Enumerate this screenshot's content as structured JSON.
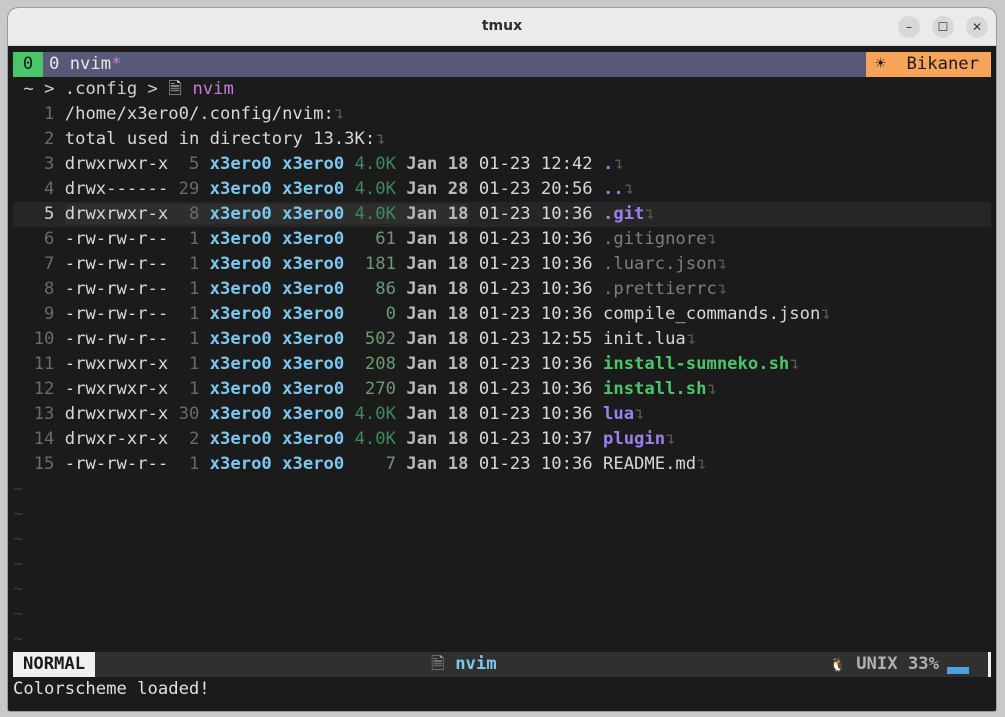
{
  "window": {
    "title": "tmux",
    "minimize_icon": "minimize-icon",
    "maximize_icon": "maximize-icon",
    "close_icon": "close-icon"
  },
  "tmux": {
    "pane_index": "0",
    "window_label": "0 nvim",
    "window_flag": "*",
    "session": "☀  Bikaner"
  },
  "breadcrumb": {
    "home": "~",
    "sep1": " > ",
    "dir": ".config",
    "sep2": " > ",
    "file_icon": "🗎",
    "current": "nvim"
  },
  "lines": [
    {
      "n": "1",
      "text": "/home/x3ero0/.config/nvim:"
    },
    {
      "n": "2",
      "text": "total used in directory 13.3K:"
    },
    {
      "n": "3",
      "perm": "drwxrwxr-x",
      "links": " 5",
      "user": "x3ero0",
      "group": "x3ero0",
      "size": "4.0K",
      "mon": "Jan",
      "day": "18",
      "time": "01-23 12:42",
      "name": ".",
      "kind": "dir"
    },
    {
      "n": "4",
      "perm": "drwx------",
      "links": "29",
      "user": "x3ero0",
      "group": "x3ero0",
      "size": "4.0K",
      "mon": "Jan",
      "day": "28",
      "time": "01-23 20:56",
      "name": "..",
      "kind": "dir"
    },
    {
      "n": "5",
      "perm": "drwxrwxr-x",
      "links": " 8",
      "user": "x3ero0",
      "group": "x3ero0",
      "size": "4.0K",
      "mon": "Jan",
      "day": "18",
      "time": "01-23 10:36",
      "name": ".git",
      "kind": "dir",
      "current": true
    },
    {
      "n": "6",
      "perm": "-rw-rw-r--",
      "links": " 1",
      "user": "x3ero0",
      "group": "x3ero0",
      "size": "  61",
      "mon": "Jan",
      "day": "18",
      "time": "01-23 10:36",
      "name": ".gitignore",
      "kind": "hidden"
    },
    {
      "n": "7",
      "perm": "-rw-rw-r--",
      "links": " 1",
      "user": "x3ero0",
      "group": "x3ero0",
      "size": " 181",
      "mon": "Jan",
      "day": "18",
      "time": "01-23 10:36",
      "name": ".luarc.json",
      "kind": "hidden"
    },
    {
      "n": "8",
      "perm": "-rw-rw-r--",
      "links": " 1",
      "user": "x3ero0",
      "group": "x3ero0",
      "size": "  86",
      "mon": "Jan",
      "day": "18",
      "time": "01-23 10:36",
      "name": ".prettierrc",
      "kind": "hidden"
    },
    {
      "n": "9",
      "perm": "-rw-rw-r--",
      "links": " 1",
      "user": "x3ero0",
      "group": "x3ero0",
      "size": "   0",
      "mon": "Jan",
      "day": "18",
      "time": "01-23 10:36",
      "name": "compile_commands.json",
      "kind": "plain"
    },
    {
      "n": "10",
      "perm": "-rw-rw-r--",
      "links": " 1",
      "user": "x3ero0",
      "group": "x3ero0",
      "size": " 502",
      "mon": "Jan",
      "day": "18",
      "time": "01-23 12:55",
      "name": "init.lua",
      "kind": "plain"
    },
    {
      "n": "11",
      "perm": "-rwxrwxr-x",
      "links": " 1",
      "user": "x3ero0",
      "group": "x3ero0",
      "size": " 208",
      "mon": "Jan",
      "day": "18",
      "time": "01-23 10:36",
      "name": "install-sumneko.sh",
      "kind": "exec"
    },
    {
      "n": "12",
      "perm": "-rwxrwxr-x",
      "links": " 1",
      "user": "x3ero0",
      "group": "x3ero0",
      "size": " 270",
      "mon": "Jan",
      "day": "18",
      "time": "01-23 10:36",
      "name": "install.sh",
      "kind": "exec"
    },
    {
      "n": "13",
      "perm": "drwxrwxr-x",
      "links": "30",
      "user": "x3ero0",
      "group": "x3ero0",
      "size": "4.0K",
      "mon": "Jan",
      "day": "18",
      "time": "01-23 10:36",
      "name": "lua",
      "kind": "dir"
    },
    {
      "n": "14",
      "perm": "drwxr-xr-x",
      "links": " 2",
      "user": "x3ero0",
      "group": "x3ero0",
      "size": "4.0K",
      "mon": "Jan",
      "day": "18",
      "time": "01-23 10:37",
      "name": "plugin",
      "kind": "dir"
    },
    {
      "n": "15",
      "perm": "-rw-rw-r--",
      "links": " 1",
      "user": "x3ero0",
      "group": "x3ero0",
      "size": "   7",
      "mon": "Jan",
      "day": "18",
      "time": "01-23 10:36",
      "name": "README.md",
      "kind": "plain"
    }
  ],
  "eol_marker": "↴",
  "tilde": "~",
  "statusline": {
    "mode": "NORMAL",
    "file_icon": "🗎",
    "file": "nvim",
    "os_icon": "🐧",
    "format": "UNIX",
    "percent": "33%"
  },
  "cmdline": "Colorscheme loaded!"
}
